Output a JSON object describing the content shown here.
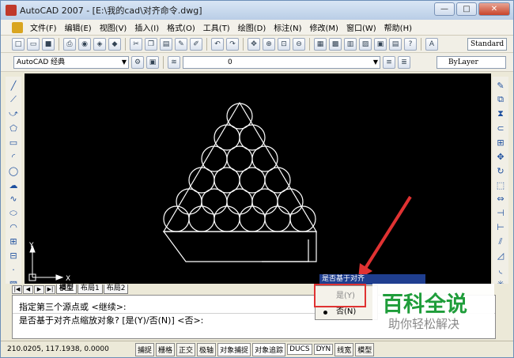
{
  "window": {
    "title": "AutoCAD 2007 - [E:\\我的cad\\对齐命令.dwg]",
    "min_label": "—",
    "max_label": "□",
    "close_label": "✕"
  },
  "menu": {
    "items": [
      "文件(F)",
      "编辑(E)",
      "视图(V)",
      "插入(I)",
      "格式(O)",
      "工具(T)",
      "绘图(D)",
      "标注(N)",
      "修改(M)",
      "窗口(W)",
      "帮助(H)"
    ]
  },
  "toolbar": {
    "text_style": "Standard",
    "workspace": "AutoCAD 经典",
    "layer": "0",
    "color": "ByLayer"
  },
  "canvas": {
    "ucs_x": "X",
    "ucs_y": "Y"
  },
  "tabs": {
    "items": [
      "模型",
      "布局1",
      "布局2"
    ]
  },
  "tooltip": {
    "text": "是否基于对齐"
  },
  "popup": {
    "yes": "是(Y)",
    "no": "否(N)"
  },
  "command": {
    "line1": "指定第三个源点或 <继续>:",
    "line2": "是否基于对齐点缩放对象? [是(Y)/否(N)] <否>:"
  },
  "status": {
    "coords": "210.0205,  117.1938, 0.0000",
    "buttons": [
      "捕捉",
      "栅格",
      "正交",
      "极轴",
      "对象捕捉",
      "对象追踪",
      "DUCS",
      "DYN",
      "线宽",
      "模型"
    ]
  },
  "watermark": {
    "title": "百科全说",
    "subtitle": "助你轻松解决"
  }
}
